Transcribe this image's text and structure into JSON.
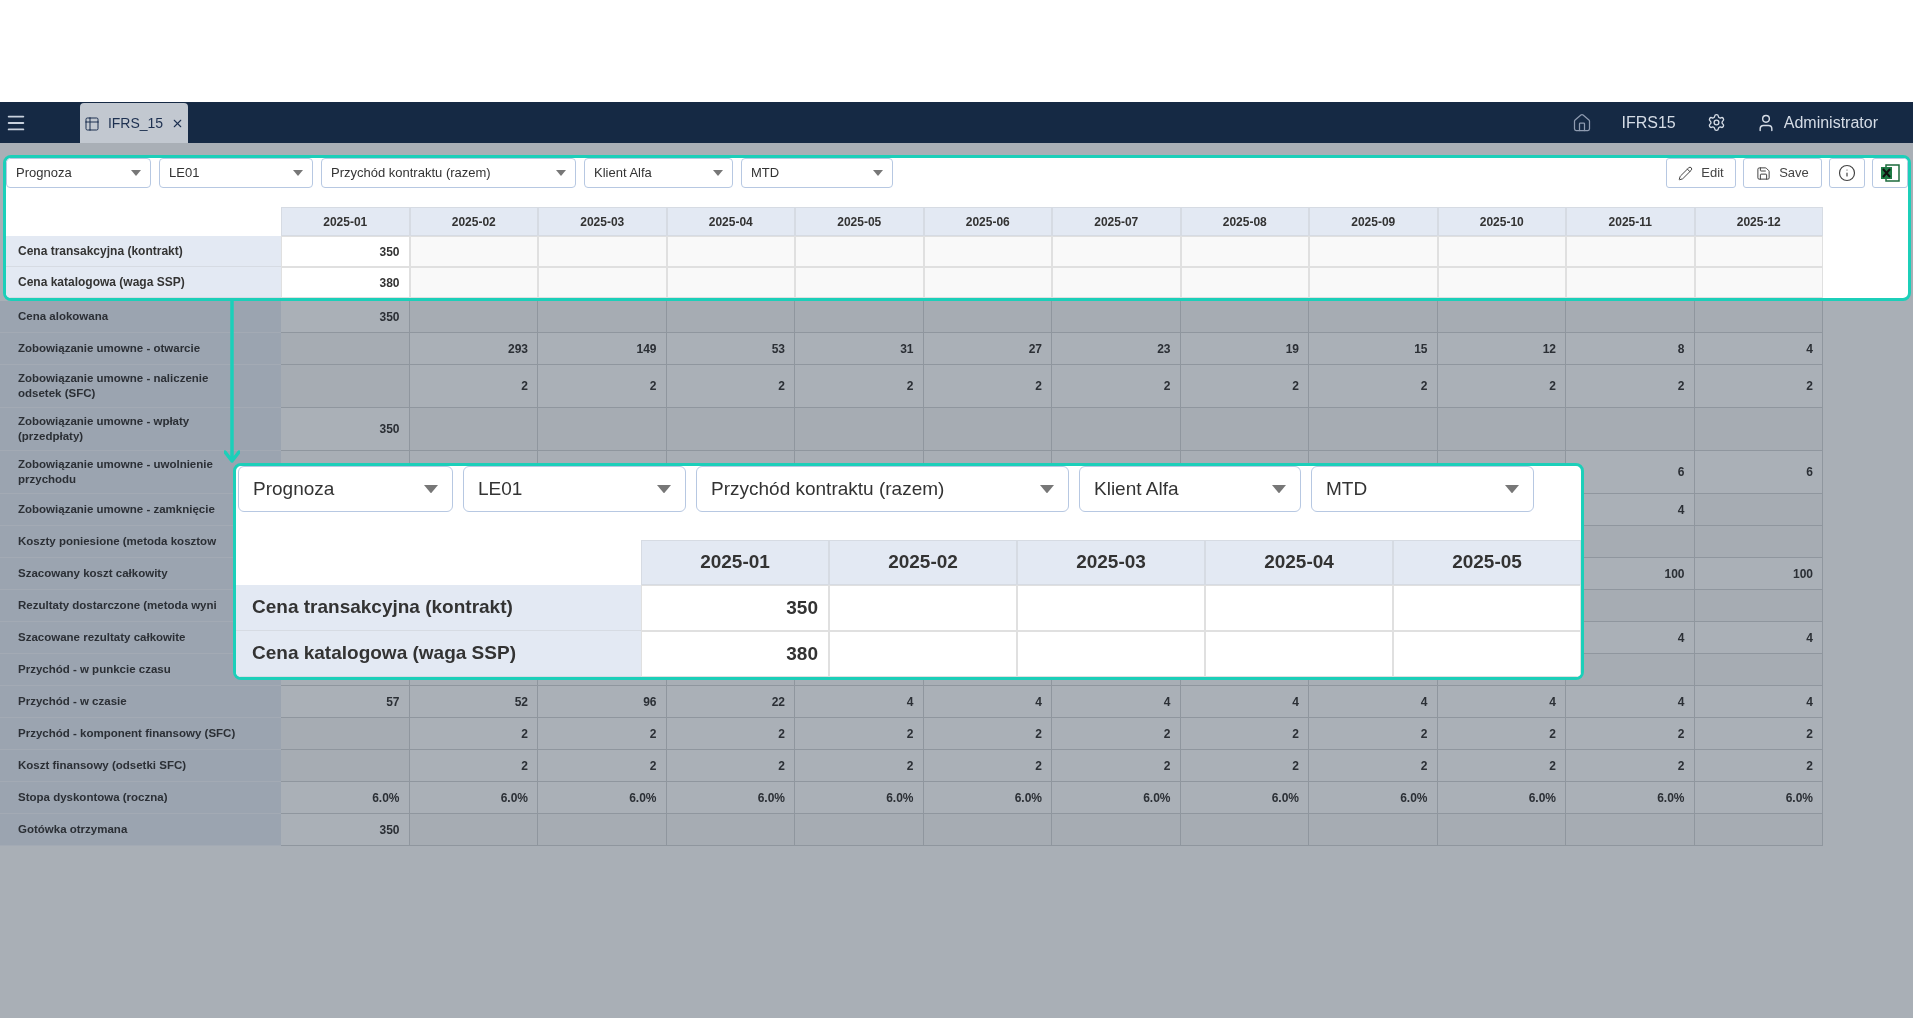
{
  "top_bar": {
    "tab": {
      "label": "IFRS_15",
      "selected": true
    },
    "app_name": "IFRS15",
    "user": "Administrator"
  },
  "filters": [
    {
      "value": "Prognoza"
    },
    {
      "value": "LE01"
    },
    {
      "value": "Przychód kontraktu (razem)"
    },
    {
      "value": "Klient Alfa"
    },
    {
      "value": "MTD"
    }
  ],
  "actions": [
    {
      "kind": "edit",
      "label": "Edit"
    },
    {
      "kind": "save",
      "label": "Save"
    },
    {
      "kind": "info"
    },
    {
      "kind": "excel"
    }
  ],
  "table": {
    "columns": [
      "2025-01",
      "2025-02",
      "2025-03",
      "2025-04",
      "2025-05",
      "2025-06",
      "2025-07",
      "2025-08",
      "2025-09",
      "2025-10",
      "2025-11",
      "2025-12"
    ],
    "rows": [
      {
        "label": "Cena transakcyjna (kontrakt)",
        "highlighted": true,
        "cells": [
          {
            "blank": false,
            "value": "350"
          },
          {
            "blank": true
          },
          {
            "blank": true
          },
          {
            "blank": true
          },
          {
            "blank": true
          },
          {
            "blank": true
          },
          {
            "blank": true
          },
          {
            "blank": true
          },
          {
            "blank": true
          },
          {
            "blank": true
          },
          {
            "blank": true
          },
          {
            "blank": true
          }
        ]
      },
      {
        "label": "Cena katalogowa (waga SSP)",
        "highlighted": true,
        "cells": [
          {
            "blank": false,
            "value": "380"
          },
          {
            "blank": true
          },
          {
            "blank": true
          },
          {
            "blank": true
          },
          {
            "blank": true
          },
          {
            "blank": true
          },
          {
            "blank": true
          },
          {
            "blank": true
          },
          {
            "blank": true
          },
          {
            "blank": true
          },
          {
            "blank": true
          },
          {
            "blank": true
          }
        ]
      },
      {
        "label": "Cena alokowana",
        "highlighted": false,
        "cells": [
          {
            "blank": false,
            "value": "350"
          },
          {
            "blank": true
          },
          {
            "blank": true
          },
          {
            "blank": true
          },
          {
            "blank": true
          },
          {
            "blank": true
          },
          {
            "blank": true
          },
          {
            "blank": true
          },
          {
            "blank": true
          },
          {
            "blank": true
          },
          {
            "blank": true
          },
          {
            "blank": true
          }
        ]
      },
      {
        "label": "Zobowiązanie umowne - otwarcie",
        "highlighted": false,
        "cells": [
          {
            "blank": true
          },
          {
            "blank": false,
            "value": "293"
          },
          {
            "blank": false,
            "value": "149"
          },
          {
            "blank": false,
            "value": "53"
          },
          {
            "blank": false,
            "value": "31"
          },
          {
            "blank": false,
            "value": "27"
          },
          {
            "blank": false,
            "value": "23"
          },
          {
            "blank": false,
            "value": "19"
          },
          {
            "blank": false,
            "value": "15"
          },
          {
            "blank": false,
            "value": "12"
          },
          {
            "blank": false,
            "value": "8"
          },
          {
            "blank": false,
            "value": "4"
          }
        ]
      },
      {
        "label": "Zobowiązanie umowne - naliczenie odsetek (SFC)",
        "highlighted": false,
        "cells": [
          {
            "blank": true
          },
          {
            "blank": false,
            "value": "2"
          },
          {
            "blank": false,
            "value": "2"
          },
          {
            "blank": false,
            "value": "2"
          },
          {
            "blank": false,
            "value": "2"
          },
          {
            "blank": false,
            "value": "2"
          },
          {
            "blank": false,
            "value": "2"
          },
          {
            "blank": false,
            "value": "2"
          },
          {
            "blank": false,
            "value": "2"
          },
          {
            "blank": false,
            "value": "2"
          },
          {
            "blank": false,
            "value": "2"
          },
          {
            "blank": false,
            "value": "2"
          }
        ]
      },
      {
        "label": "Zobowiązanie umowne - wpłaty (przedpłaty)",
        "highlighted": false,
        "cells": [
          {
            "blank": false,
            "value": "350"
          },
          {
            "blank": true
          },
          {
            "blank": true
          },
          {
            "blank": true
          },
          {
            "blank": true
          },
          {
            "blank": true
          },
          {
            "blank": true
          },
          {
            "blank": true
          },
          {
            "blank": true
          },
          {
            "blank": true
          },
          {
            "blank": true
          },
          {
            "blank": true
          }
        ]
      },
      {
        "label": "Zobowiązanie umowne - uwolnienie przychodu",
        "highlighted": false,
        "cells": [
          {
            "blank": false,
            "value": "6"
          },
          {
            "blank": false,
            "value": "6"
          }
        ]
      },
      {
        "label": "Zobowiązanie umowne - zamknięcie",
        "highlighted": false,
        "cells": [
          {
            "blank": false,
            "value": "4"
          },
          {
            "blank": true
          }
        ]
      },
      {
        "label": "Koszty poniesione (metoda kosztow",
        "highlighted": false,
        "cells": [
          {
            "blank": true
          },
          {
            "blank": true
          }
        ]
      },
      {
        "label": "Szacowany koszt całkowity",
        "highlighted": false,
        "cells": [
          {
            "blank": false,
            "value": "100"
          },
          {
            "blank": false,
            "value": "100"
          }
        ]
      },
      {
        "label": "Rezultaty dostarczone (metoda wyni",
        "highlighted": false,
        "cells": [
          {
            "blank": true
          },
          {
            "blank": true
          }
        ]
      },
      {
        "label": "Szacowane rezultaty całkowite",
        "highlighted": false,
        "cells": [
          {
            "blank": false,
            "value": "4"
          },
          {
            "blank": false,
            "value": "4"
          }
        ]
      },
      {
        "label": "Przychód - w punkcie czasu",
        "highlighted": false,
        "cells": [
          {
            "blank": true
          },
          {
            "blank": true
          }
        ]
      },
      {
        "label": "Przychód - w czasie",
        "highlighted": false,
        "cells": [
          {
            "blank": false,
            "value": "57"
          },
          {
            "blank": false,
            "value": "52"
          },
          {
            "blank": false,
            "value": "96"
          },
          {
            "blank": false,
            "value": "22"
          },
          {
            "blank": false,
            "value": "4"
          },
          {
            "blank": false,
            "value": "4"
          },
          {
            "blank": false,
            "value": "4"
          },
          {
            "blank": false,
            "value": "4"
          },
          {
            "blank": false,
            "value": "4"
          },
          {
            "blank": false,
            "value": "4"
          },
          {
            "blank": false,
            "value": "4"
          },
          {
            "blank": false,
            "value": "4"
          }
        ]
      },
      {
        "label": "Przychód - komponent finansowy (SFC)",
        "highlighted": false,
        "cells": [
          {
            "blank": true
          },
          {
            "blank": false,
            "value": "2"
          },
          {
            "blank": false,
            "value": "2"
          },
          {
            "blank": false,
            "value": "2"
          },
          {
            "blank": false,
            "value": "2"
          },
          {
            "blank": false,
            "value": "2"
          },
          {
            "blank": false,
            "value": "2"
          },
          {
            "blank": false,
            "value": "2"
          },
          {
            "blank": false,
            "value": "2"
          },
          {
            "blank": false,
            "value": "2"
          },
          {
            "blank": false,
            "value": "2"
          },
          {
            "blank": false,
            "value": "2"
          }
        ]
      },
      {
        "label": "Koszt finansowy (odsetki SFC)",
        "highlighted": false,
        "cells": [
          {
            "blank": true
          },
          {
            "blank": false,
            "value": "2"
          },
          {
            "blank": false,
            "value": "2"
          },
          {
            "blank": false,
            "value": "2"
          },
          {
            "blank": false,
            "value": "2"
          },
          {
            "blank": false,
            "value": "2"
          },
          {
            "blank": false,
            "value": "2"
          },
          {
            "blank": false,
            "value": "2"
          },
          {
            "blank": false,
            "value": "2"
          },
          {
            "blank": false,
            "value": "2"
          },
          {
            "blank": false,
            "value": "2"
          },
          {
            "blank": false,
            "value": "2"
          }
        ]
      },
      {
        "label": "Stopa dyskontowa (roczna)",
        "highlighted": false,
        "cells": [
          {
            "blank": false,
            "value": "6.0%"
          },
          {
            "blank": false,
            "value": "6.0%"
          },
          {
            "blank": false,
            "value": "6.0%"
          },
          {
            "blank": false,
            "value": "6.0%"
          },
          {
            "blank": false,
            "value": "6.0%"
          },
          {
            "blank": false,
            "value": "6.0%"
          },
          {
            "blank": false,
            "value": "6.0%"
          },
          {
            "blank": false,
            "value": "6.0%"
          },
          {
            "blank": false,
            "value": "6.0%"
          },
          {
            "blank": false,
            "value": "6.0%"
          },
          {
            "blank": false,
            "value": "6.0%"
          },
          {
            "blank": false,
            "value": "6.0%"
          }
        ]
      },
      {
        "label": "Gotówka otrzymana",
        "highlighted": false,
        "cells": [
          {
            "blank": false,
            "value": "350"
          },
          {
            "blank": true
          },
          {
            "blank": true
          },
          {
            "blank": true
          },
          {
            "blank": true
          },
          {
            "blank": true
          },
          {
            "blank": true
          },
          {
            "blank": true
          },
          {
            "blank": true
          },
          {
            "blank": true
          },
          {
            "blank": true
          },
          {
            "blank": true
          }
        ]
      }
    ]
  },
  "callout": {
    "filters": [
      {
        "value": "Prognoza"
      },
      {
        "value": "LE01"
      },
      {
        "value": "Przychód kontraktu (razem)"
      },
      {
        "value": "Klient Alfa"
      },
      {
        "value": "MTD"
      }
    ],
    "columns": [
      "2025-01",
      "2025-02",
      "2025-03",
      "2025-04",
      "2025-05"
    ],
    "rows": [
      {
        "label": "Cena transakcyjna (kontrakt)",
        "values": [
          "350"
        ]
      },
      {
        "label": "Cena katalogowa (waga SSP)",
        "values": [
          "380"
        ]
      }
    ]
  }
}
